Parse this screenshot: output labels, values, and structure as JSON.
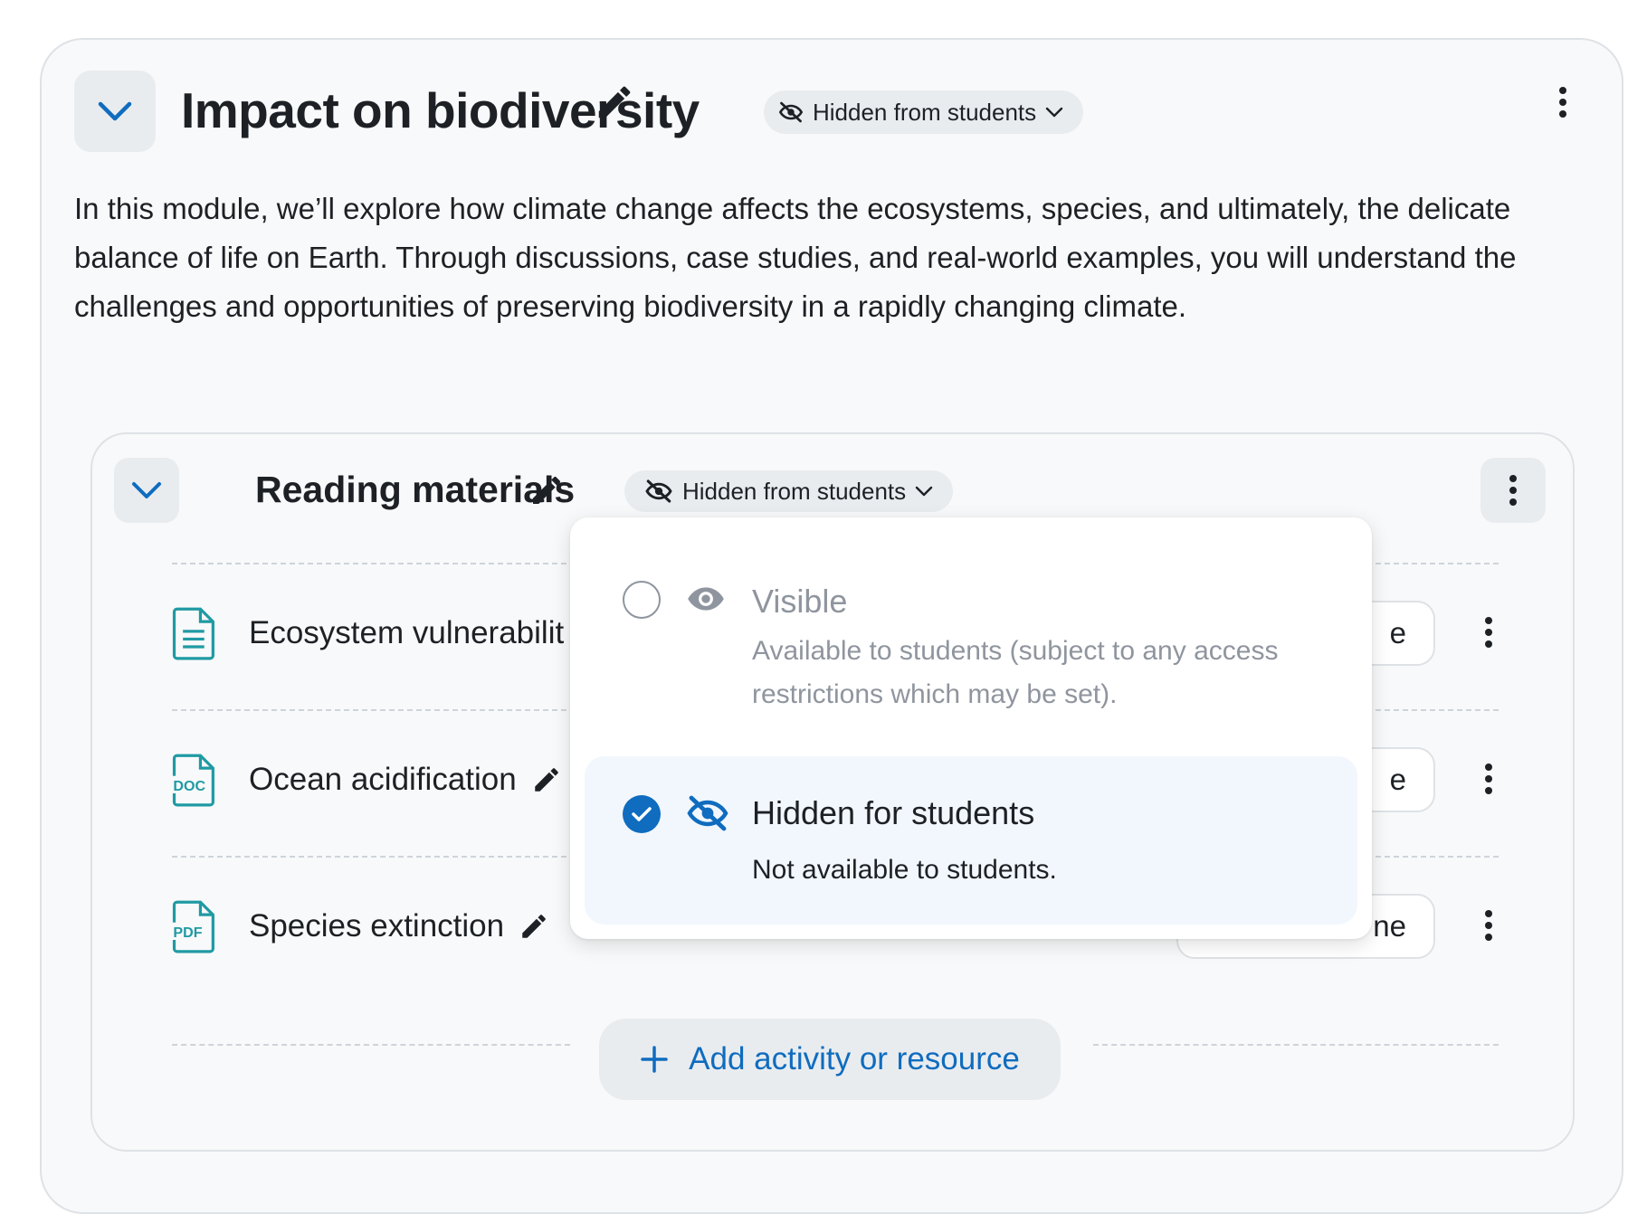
{
  "section": {
    "title": "Impact on biodiversity",
    "visibility_label": "Hidden from students",
    "summary": "In this module, we’ll explore how climate change affects the ecosystems, species, and ultimately, the delicate balance of life on Earth. Through discussions, case studies, and real-world examples, you will understand the challenges and opportunities of preserving biodiversity in a rapidly changing climate."
  },
  "subsection": {
    "title": "Reading materials",
    "visibility_label": "Hidden from students",
    "activities": [
      {
        "name": "Ecosystem vulnerabilit",
        "icon": "document-icon",
        "side_label": "e"
      },
      {
        "name": "Ocean acidification",
        "icon": "doc-file-icon",
        "file_badge": "DOC",
        "side_label": "e"
      },
      {
        "name": "Species extinction",
        "icon": "pdf-file-icon",
        "file_badge": "PDF",
        "side_label": "ne"
      }
    ],
    "add_button_label": "Add activity or resource"
  },
  "visibility_menu": {
    "options": [
      {
        "title": "Visible",
        "description": "Available to students (subject to any access restrictions which may be set).",
        "selected": false,
        "icon": "eye-icon"
      },
      {
        "title": "Hidden for students",
        "description": "Not available to students.",
        "selected": true,
        "icon": "eye-slash-icon"
      }
    ]
  },
  "colors": {
    "accent": "#0f6cbf",
    "text": "#1d2125",
    "muted": "#8f959e",
    "teal_icon": "#1f9aa3",
    "card_bg": "#f8f9fa",
    "selected_bg": "#f1f7fd"
  }
}
